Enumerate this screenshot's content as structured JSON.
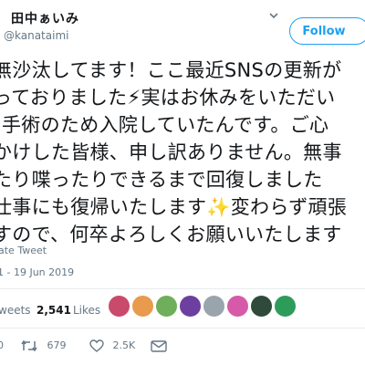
{
  "user": {
    "name": "田中ぁいみ",
    "handle": "@kanataimi"
  },
  "follow_label": "Follow",
  "tweet": {
    "lines": [
      "無沙汰してます！ここ最近SNSの更新が",
      "っておりました⚡実はお休みをいただい",
      "手術のため入院していたんです。ご心",
      "かけした皆様、申し訳ありません。無事",
      "たり喋ったりできるまで回復しました",
      "仕事にも復帰いたします✨変わらず頑張",
      "すので、何卒よろしくお願いいたします"
    ]
  },
  "translate_label": "ate Tweet",
  "timestamp": "1 - 19 Jun 2019",
  "stats": {
    "retweets_label": "weets",
    "likes_count": "2,541",
    "likes_label": "Likes"
  },
  "avatars": [
    {
      "name": "avatar-1",
      "color": "#c94a6a"
    },
    {
      "name": "avatar-2",
      "color": "#e89a4d"
    },
    {
      "name": "avatar-3",
      "color": "#6fae5a"
    },
    {
      "name": "avatar-4",
      "color": "#6d3fa0"
    },
    {
      "name": "avatar-5",
      "color": "#9aa4ad"
    },
    {
      "name": "avatar-6",
      "color": "#d65aa8"
    },
    {
      "name": "avatar-7",
      "color": "#2f4a3a"
    },
    {
      "name": "avatar-8",
      "color": "#2d9c5a"
    }
  ],
  "actions": {
    "reply_count": "0",
    "retweet_count": "679",
    "like_count": "2.5K"
  },
  "colors": {
    "accent": "#1da1f2",
    "muted": "#657786",
    "like_red": "#e0245e"
  }
}
